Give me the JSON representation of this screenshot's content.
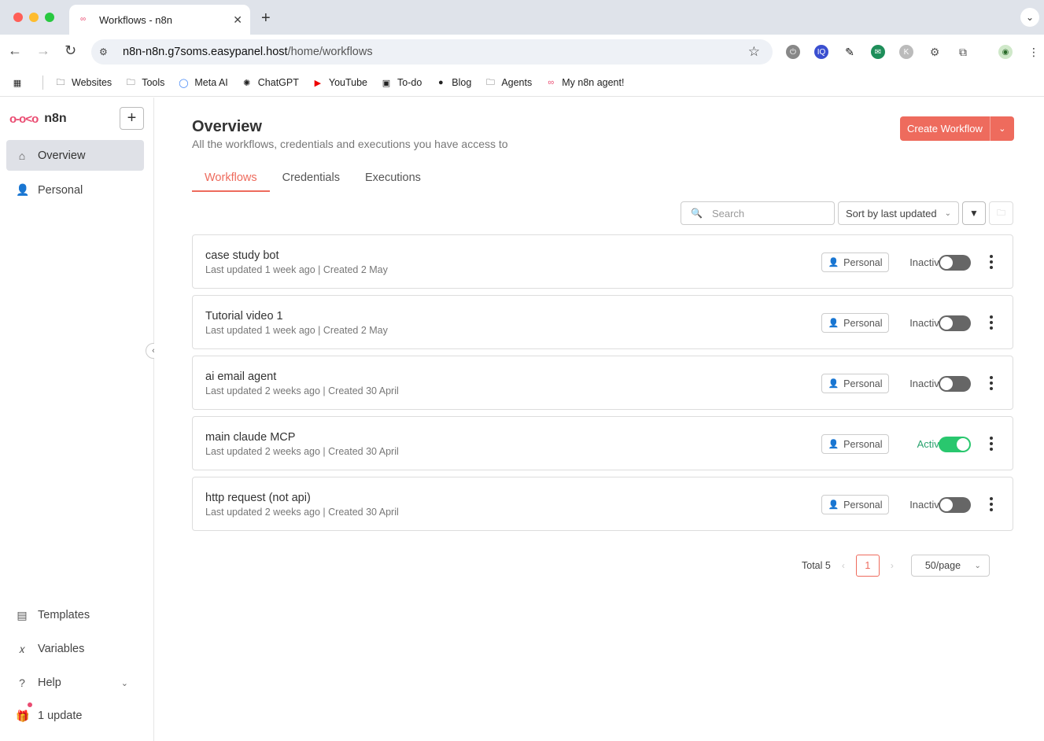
{
  "browser": {
    "tab_title": "Workflows - n8n",
    "url_host": "n8n-n8n.g7soms.easypanel.host",
    "url_path": "/home/workflows",
    "bookmarks": [
      "Websites",
      "Tools",
      "Meta AI",
      "ChatGPT",
      "YouTube",
      "To-do",
      "Blog",
      "Agents",
      "My n8n agent!"
    ]
  },
  "sidebar": {
    "logo": "n8n",
    "items": [
      {
        "label": "Overview",
        "icon": "home-icon",
        "active": true
      },
      {
        "label": "Personal",
        "icon": "user-icon",
        "active": false
      }
    ],
    "bottom": [
      {
        "label": "Templates",
        "icon": "templates-icon"
      },
      {
        "label": "Variables",
        "icon": "variables-icon"
      },
      {
        "label": "Help",
        "icon": "help-icon"
      },
      {
        "label": "1 update",
        "icon": "gift-icon"
      }
    ]
  },
  "header": {
    "title": "Overview",
    "subtitle": "All the workflows, credentials and executions you have access to",
    "create_label": "Create Workflow"
  },
  "tabs": [
    {
      "label": "Workflows",
      "active": true
    },
    {
      "label": "Credentials",
      "active": false
    },
    {
      "label": "Executions",
      "active": false
    }
  ],
  "controls": {
    "search_placeholder": "Search",
    "sort_label": "Sort by last updated"
  },
  "workflows": [
    {
      "name": "case study bot",
      "meta": "Last updated 1 week ago | Created 2 May",
      "owner": "Personal",
      "status": "Inactive",
      "active": false
    },
    {
      "name": "Tutorial video 1",
      "meta": "Last updated 1 week ago | Created 2 May",
      "owner": "Personal",
      "status": "Inactive",
      "active": false
    },
    {
      "name": "ai email agent",
      "meta": "Last updated 2 weeks ago | Created 30 April",
      "owner": "Personal",
      "status": "Inactive",
      "active": false
    },
    {
      "name": "main claude MCP",
      "meta": "Last updated 2 weeks ago | Created 30 April",
      "owner": "Personal",
      "status": "Active",
      "active": true
    },
    {
      "name": "http request (not api)",
      "meta": "Last updated 2 weeks ago | Created 30 April",
      "owner": "Personal",
      "status": "Inactive",
      "active": false
    }
  ],
  "pagination": {
    "total": "Total 5",
    "current_page": "1",
    "page_size": "50/page"
  },
  "colors": {
    "accent": "#ee6b5d",
    "brand": "#ea4b71",
    "active": "#29c76e"
  }
}
